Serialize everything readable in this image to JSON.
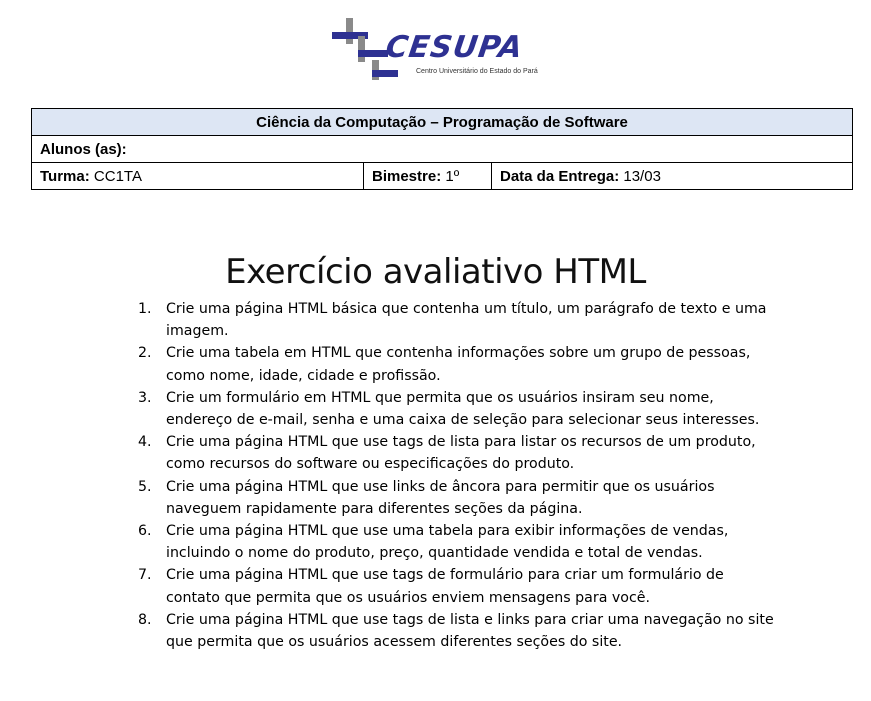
{
  "logo": {
    "brand": "CESUPA",
    "subtitle": "Centro Universitário do Estado do Pará"
  },
  "header_table": {
    "title": "Ciência da Computação – Programação de Software",
    "alunos_label": "Alunos (as):",
    "turma_label": "Turma:",
    "turma_value": "CC1TA",
    "bimestre_label": "Bimestre:",
    "bimestre_value": "1º",
    "data_label": "Data da Entrega:",
    "data_value": "13/03"
  },
  "document": {
    "title": "Exercício avaliativo HTML",
    "tasks": [
      {
        "num": "1.",
        "text": "Crie uma página HTML básica que contenha um título, um parágrafo de texto e uma imagem."
      },
      {
        "num": "2.",
        "text": "Crie uma tabela em HTML que contenha informações sobre um grupo de pessoas, como nome, idade, cidade e profissão."
      },
      {
        "num": "3.",
        "text": "Crie um formulário em HTML que permita que os usuários insiram seu nome, endereço de e-mail, senha e uma caixa de seleção para selecionar seus interesses."
      },
      {
        "num": "4.",
        "text": "Crie uma página HTML que use tags de lista para listar os recursos de um produto, como recursos do software ou especificações do produto."
      },
      {
        "num": "5.",
        "text": "Crie uma página HTML que use links de âncora para permitir que os usuários naveguem rapidamente para diferentes seções da página."
      },
      {
        "num": "6.",
        "text": "Crie uma página HTML que use uma tabela para exibir informações de vendas, incluindo o nome do produto, preço, quantidade vendida e total de vendas."
      },
      {
        "num": "7.",
        "text": "Crie uma página HTML que use tags de formulário para criar um formulário de contato que permita que os usuários enviem mensagens para você."
      },
      {
        "num": "8.",
        "text": "Crie uma página HTML que use tags de lista e links para criar uma navegação no site que permita que os usuários acessem diferentes seções do site."
      }
    ]
  },
  "colors": {
    "brand_blue": "#2e3192",
    "header_fill": "#dde6f4"
  }
}
